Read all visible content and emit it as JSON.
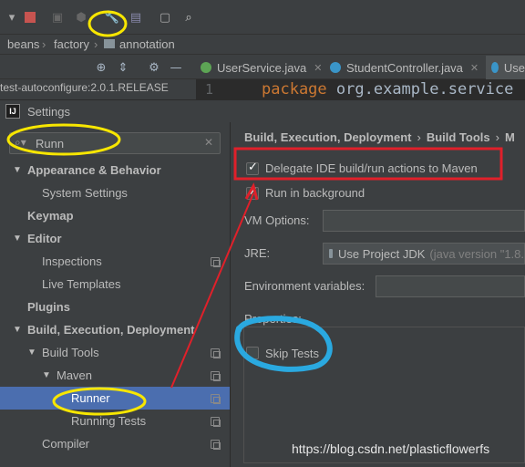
{
  "breadcrumbs": [
    "beans",
    "factory",
    "annotation"
  ],
  "tabs": [
    {
      "label": "UserService.java",
      "icon": "interface-icon"
    },
    {
      "label": "StudentController.java",
      "icon": "class-icon"
    },
    {
      "label": "Use",
      "icon": "class-icon"
    }
  ],
  "project_line": "test-autoconfigure:2.0.1.RELEASE",
  "editor": {
    "line_number": "1",
    "keyword": "package",
    "package_name": "org.example.service"
  },
  "dialog": {
    "title": "Settings",
    "search_value": "Runn",
    "tree": [
      {
        "label": "Appearance & Behavior",
        "bold": true,
        "expanded": true
      },
      {
        "label": "System Settings"
      },
      {
        "label": "Keymap",
        "bold": true
      },
      {
        "label": "Editor",
        "bold": true,
        "expanded": true
      },
      {
        "label": "Inspections"
      },
      {
        "label": "Live Templates"
      },
      {
        "label": "Plugins",
        "bold": true
      },
      {
        "label": "Build, Execution, Deployment",
        "bold": true,
        "expanded": true
      },
      {
        "label": "Build Tools",
        "expanded": true
      },
      {
        "label": "Maven",
        "expanded": true
      },
      {
        "label": "Runner",
        "selected": true
      },
      {
        "label": "Running Tests"
      },
      {
        "label": "Compiler"
      }
    ],
    "breadcrumb": {
      "part1": "Build, Execution, Deployment",
      "part2": "Build Tools",
      "part3": "M"
    },
    "delegate_label": "Delegate IDE build/run actions to Maven",
    "background_label": "Run in background",
    "vm_options_label": "VM Options:",
    "jre_label": "JRE:",
    "jre_value": "Use Project JDK",
    "jre_hint": "(java version \"1.8.",
    "env_label": "Environment variables:",
    "properties_label": "Properties:",
    "skip_tests_label": "Skip Tests"
  },
  "watermark": "https://blog.csdn.net/plasticflowerfs"
}
